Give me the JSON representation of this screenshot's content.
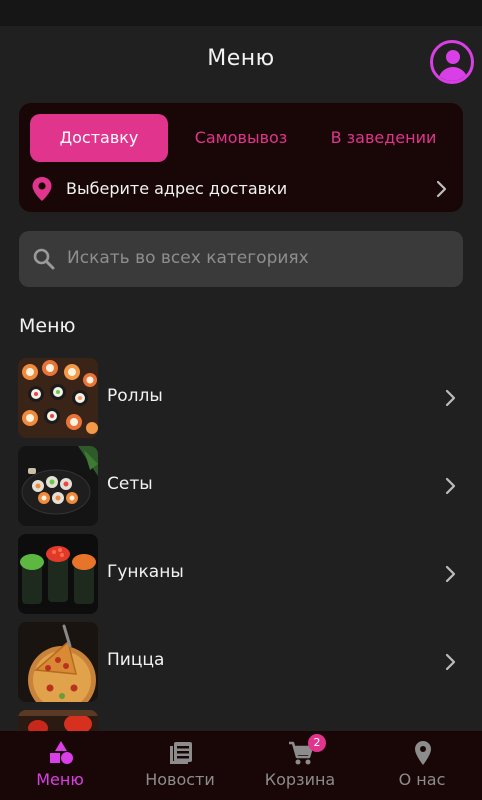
{
  "header": {
    "title": "Меню"
  },
  "delivery": {
    "tabs": [
      {
        "label": "Доставку",
        "active": true
      },
      {
        "label": "Самовывоз",
        "active": false
      },
      {
        "label": "В заведении",
        "active": false
      }
    ],
    "address_prompt": "Выберите адрес доставки"
  },
  "search": {
    "placeholder": "Искать во всех категориях"
  },
  "menu": {
    "section_title": "Меню",
    "items": [
      {
        "label": "Роллы",
        "icon": "rolls-thumbnail"
      },
      {
        "label": "Сеты",
        "icon": "sets-thumbnail"
      },
      {
        "label": "Гунканы",
        "icon": "gunkan-thumbnail"
      },
      {
        "label": "Пицца",
        "icon": "pizza-thumbnail"
      },
      {
        "label": "",
        "icon": "next-category-thumbnail"
      }
    ]
  },
  "bottom_nav": {
    "items": [
      {
        "label": "Меню",
        "icon": "shapes-icon",
        "active": true
      },
      {
        "label": "Новости",
        "icon": "news-icon",
        "active": false
      },
      {
        "label": "Корзина",
        "icon": "cart-icon",
        "active": false,
        "badge": "2"
      },
      {
        "label": "О нас",
        "icon": "location-pin-icon",
        "active": false
      }
    ]
  },
  "colors": {
    "accent": "#e0348d",
    "accent_purple": "#d93fe6",
    "background": "#202020",
    "card": "#190707"
  }
}
